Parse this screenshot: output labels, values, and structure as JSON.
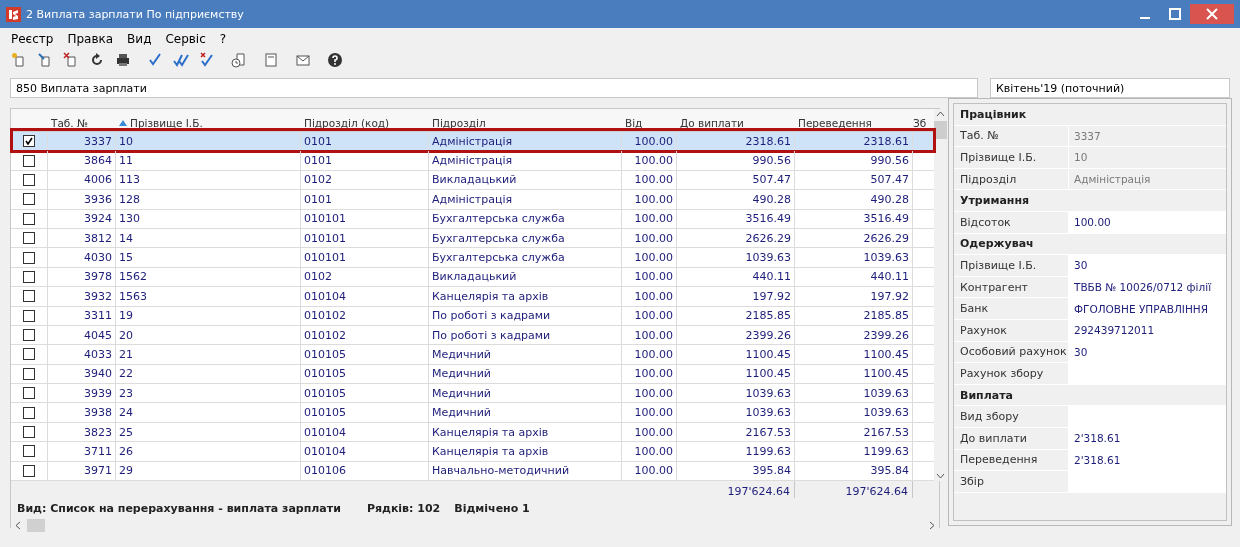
{
  "window": {
    "title": "2 Виплата зарплати По підприємству"
  },
  "menu": [
    "Реєстр",
    "Правка",
    "Вид",
    "Сервіс",
    "?"
  ],
  "register_field": {
    "value": "850 Виплата зарплати"
  },
  "period_field": {
    "value": "Квітень'19 (поточний)"
  },
  "table": {
    "columns": [
      {
        "label": "Таб. №",
        "sorted": false
      },
      {
        "label": "Прізвище І.Б.",
        "sorted": true
      },
      {
        "label": "Підрозділ (код)",
        "sorted": false
      },
      {
        "label": "Підрозділ",
        "sorted": false
      },
      {
        "label": "Від",
        "sorted": false
      },
      {
        "label": "До виплати",
        "sorted": false
      },
      {
        "label": "Переведення",
        "sorted": false
      },
      {
        "label": "Зб",
        "sorted": false
      }
    ],
    "rows": [
      {
        "cells": [
          "3337",
          "10",
          "0101",
          "Адміністрація",
          "100.00",
          "2318.61",
          "2318.61"
        ],
        "checked": true,
        "selected": true
      },
      {
        "cells": [
          "3864",
          "11",
          "0101",
          "Адміністрація",
          "100.00",
          "990.56",
          "990.56"
        ],
        "checked": false,
        "selected": false
      },
      {
        "cells": [
          "4006",
          "113",
          "0102",
          "Викладацький",
          "100.00",
          "507.47",
          "507.47"
        ],
        "checked": false,
        "selected": false
      },
      {
        "cells": [
          "3936",
          "128",
          "0101",
          "Адміністрація",
          "100.00",
          "490.28",
          "490.28"
        ],
        "checked": false,
        "selected": false
      },
      {
        "cells": [
          "3924",
          "130",
          "010101",
          "Бухгалтерська служба",
          "100.00",
          "3516.49",
          "3516.49"
        ],
        "checked": false,
        "selected": false
      },
      {
        "cells": [
          "3812",
          "14",
          "010101",
          "Бухгалтерська служба",
          "100.00",
          "2626.29",
          "2626.29"
        ],
        "checked": false,
        "selected": false
      },
      {
        "cells": [
          "4030",
          "15",
          "010101",
          "Бухгалтерська служба",
          "100.00",
          "1039.63",
          "1039.63"
        ],
        "checked": false,
        "selected": false
      },
      {
        "cells": [
          "3978",
          "1562",
          "0102",
          "Викладацький",
          "100.00",
          "440.11",
          "440.11"
        ],
        "checked": false,
        "selected": false
      },
      {
        "cells": [
          "3932",
          "1563",
          "010104",
          "Канцелярія та архів",
          "100.00",
          "197.92",
          "197.92"
        ],
        "checked": false,
        "selected": false
      },
      {
        "cells": [
          "3311",
          "19",
          "010102",
          "По роботі з кадрами",
          "100.00",
          "2185.85",
          "2185.85"
        ],
        "checked": false,
        "selected": false
      },
      {
        "cells": [
          "4045",
          "20",
          "010102",
          "По роботі з кадрами",
          "100.00",
          "2399.26",
          "2399.26"
        ],
        "checked": false,
        "selected": false
      },
      {
        "cells": [
          "4033",
          "21",
          "010105",
          "Медичний",
          "100.00",
          "1100.45",
          "1100.45"
        ],
        "checked": false,
        "selected": false
      },
      {
        "cells": [
          "3940",
          "22",
          "010105",
          "Медичний",
          "100.00",
          "1100.45",
          "1100.45"
        ],
        "checked": false,
        "selected": false
      },
      {
        "cells": [
          "3939",
          "23",
          "010105",
          "Медичний",
          "100.00",
          "1039.63",
          "1039.63"
        ],
        "checked": false,
        "selected": false
      },
      {
        "cells": [
          "3938",
          "24",
          "010105",
          "Медичний",
          "100.00",
          "1039.63",
          "1039.63"
        ],
        "checked": false,
        "selected": false
      },
      {
        "cells": [
          "3823",
          "25",
          "010104",
          "Канцелярія та архів",
          "100.00",
          "2167.53",
          "2167.53"
        ],
        "checked": false,
        "selected": false
      },
      {
        "cells": [
          "3711",
          "26",
          "010104",
          "Канцелярія та архів",
          "100.00",
          "1199.63",
          "1199.63"
        ],
        "checked": false,
        "selected": false
      },
      {
        "cells": [
          "3971",
          "29",
          "010106",
          "Навчально-методичний",
          "100.00",
          "395.84",
          "395.84"
        ],
        "checked": false,
        "selected": false
      }
    ],
    "totals": [
      "197'624.64",
      "197'624.64"
    ]
  },
  "status_bar": {
    "view": "Вид: Список на перерахування - виплата зарплати",
    "rows": "Рядків: 102",
    "marked": "Відмічено 1"
  },
  "details": [
    {
      "kind": "section",
      "label": "Працівник"
    },
    {
      "kind": "field",
      "label": "Таб. №",
      "value": "3337",
      "disabled": true
    },
    {
      "kind": "field",
      "label": "Прізвище І.Б.",
      "value": "10",
      "disabled": true
    },
    {
      "kind": "field",
      "label": "Підрозділ",
      "value": "Адміністрація",
      "disabled": true
    },
    {
      "kind": "section",
      "label": "Утримання"
    },
    {
      "kind": "field",
      "label": "Відсоток",
      "value": "100.00",
      "disabled": false
    },
    {
      "kind": "section",
      "label": "Одержувач"
    },
    {
      "kind": "field",
      "label": "Прізвище І.Б.",
      "value": "30",
      "disabled": false
    },
    {
      "kind": "field",
      "label": "Контрагент",
      "value": "ТВБВ № 10026/0712 філії",
      "disabled": false
    },
    {
      "kind": "field",
      "label": "Банк",
      "value": "ФГОЛОВНЕ УПРАВЛІННЯ",
      "disabled": false
    },
    {
      "kind": "field",
      "label": "Рахунок",
      "value": "292439712011",
      "disabled": false
    },
    {
      "kind": "field",
      "label": "Особовий рахунок",
      "value": "30",
      "disabled": false
    },
    {
      "kind": "field",
      "label": "Рахунок збору",
      "disabled": false
    },
    {
      "kind": "section",
      "label": "Виплата"
    },
    {
      "kind": "field",
      "label": "Вид збору",
      "disabled": false
    },
    {
      "kind": "field",
      "label": "До виплати",
      "value": "2'318.61",
      "disabled": false
    },
    {
      "kind": "field",
      "label": "Переведення",
      "value": "2'318.61",
      "disabled": false
    },
    {
      "kind": "field",
      "label": "Збір",
      "disabled": false
    }
  ]
}
